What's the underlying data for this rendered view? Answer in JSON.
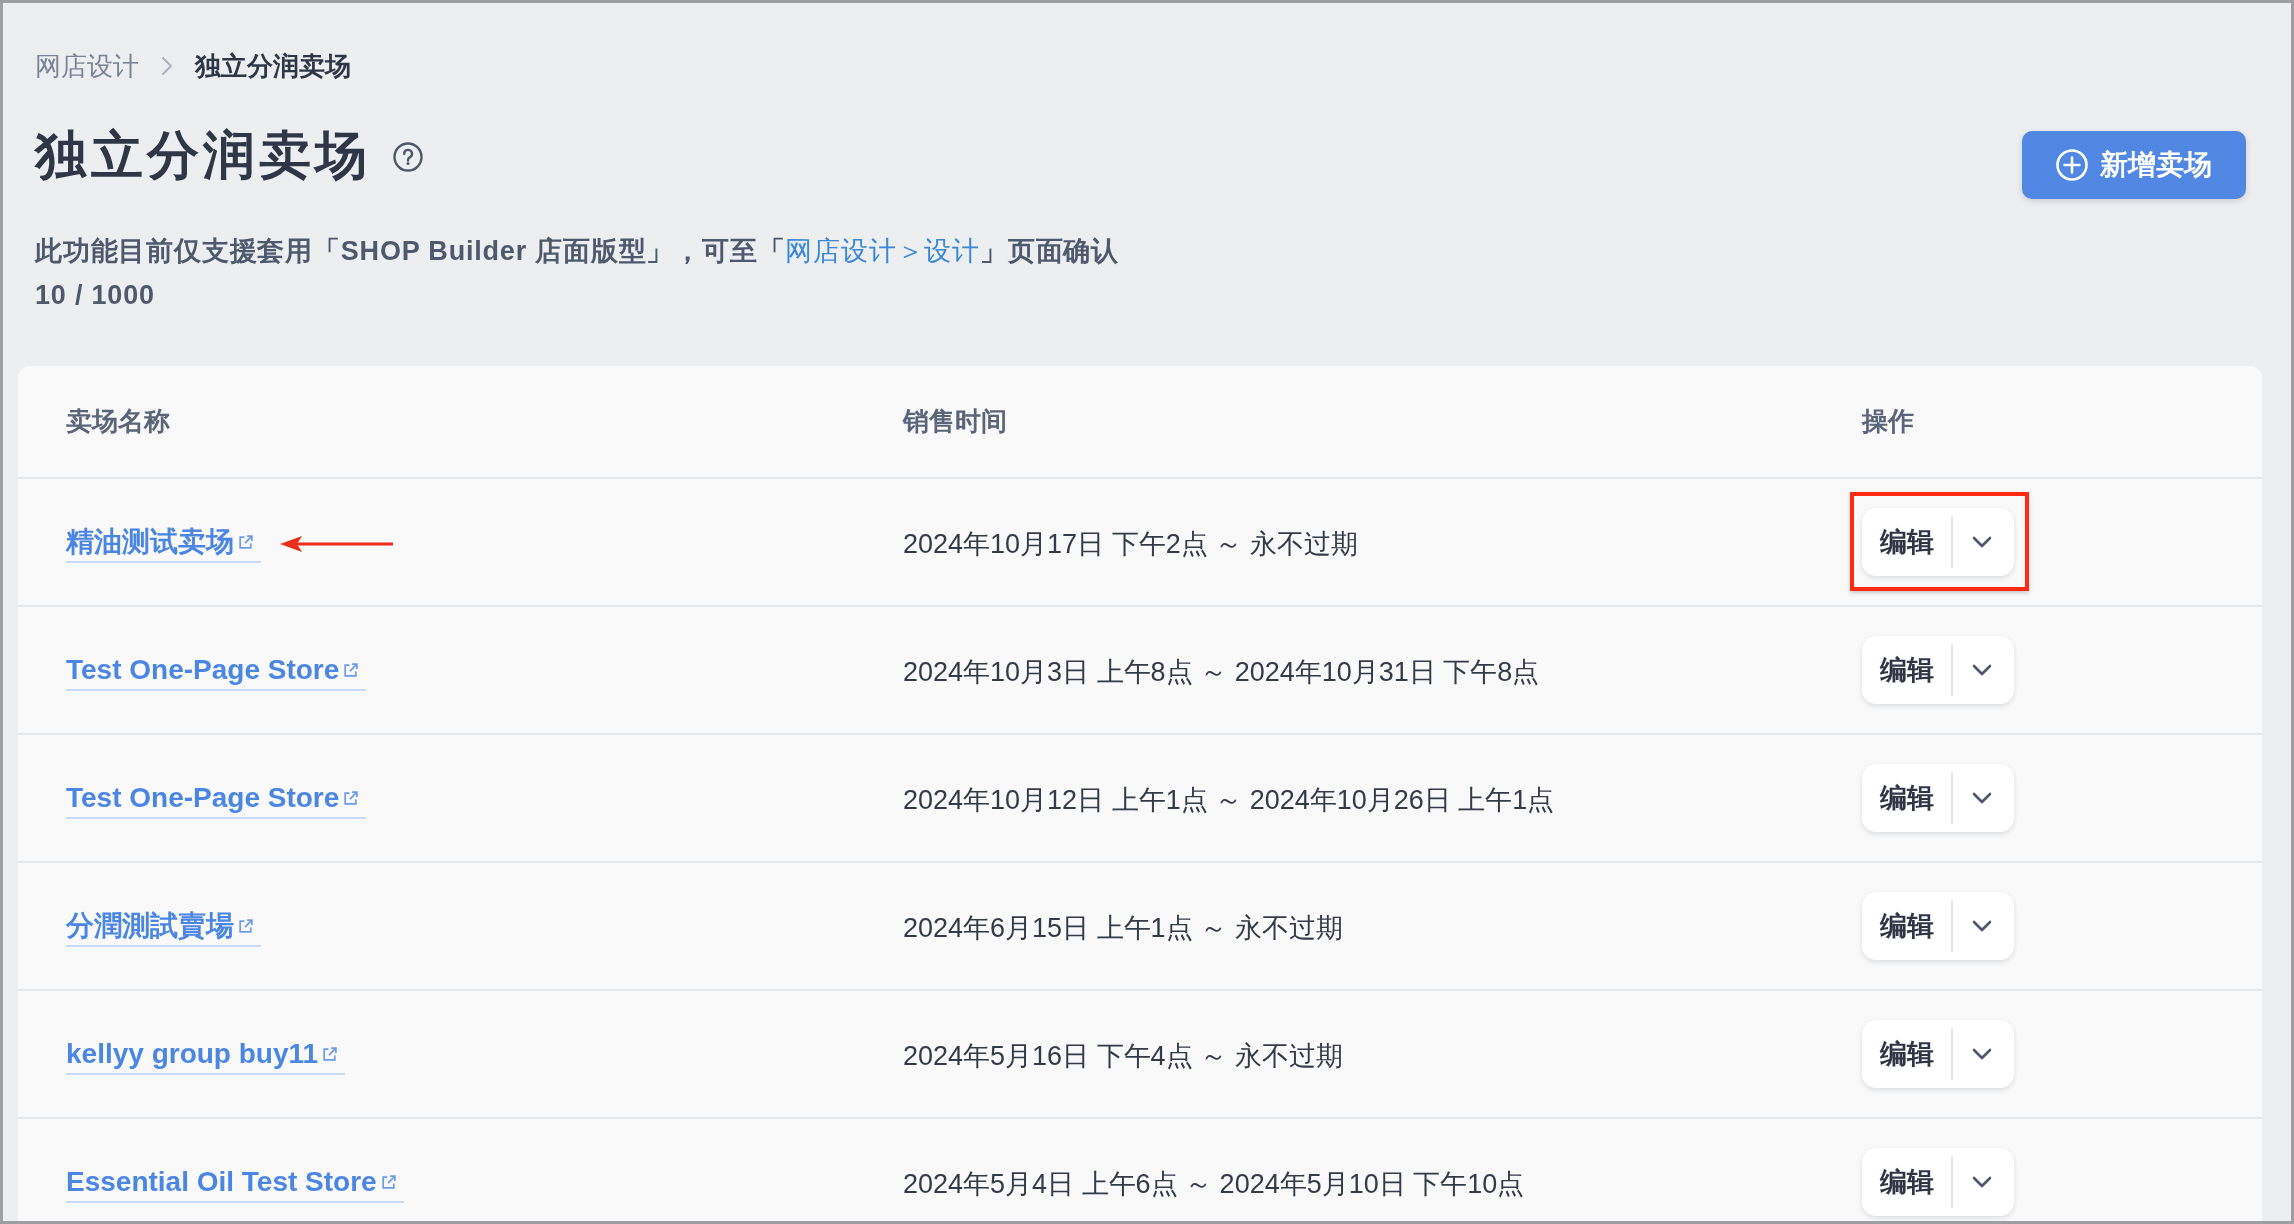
{
  "breadcrumb": [
    {
      "label": "网店设计",
      "current": false
    },
    {
      "label": "独立分润卖场",
      "current": true
    }
  ],
  "title": "独立分润卖场",
  "description": {
    "before": "此功能目前仅支援套用「SHOP Builder 店面版型」，可至「",
    "link": "网店设计＞设计",
    "after": "」页面确认"
  },
  "quota": "10 / 1000",
  "new_button": "新增卖场",
  "table": {
    "columns": [
      "卖场名称",
      "销售时间",
      "操作"
    ],
    "rows": [
      {
        "name": "精油测试卖场",
        "sale_time": "2024年10月17日 下午2点 ～ 永不过期",
        "action": "编辑",
        "arrow_annotation": true,
        "box_annotation": true
      },
      {
        "name": "Test One-Page Store",
        "sale_time": "2024年10月3日 上午8点 ～ 2024年10月31日 下午8点",
        "action": "编辑",
        "arrow_annotation": false,
        "box_annotation": false
      },
      {
        "name": "Test One-Page Store",
        "sale_time": "2024年10月12日 上午1点 ～ 2024年10月26日 上午1点",
        "action": "编辑",
        "arrow_annotation": false,
        "box_annotation": false
      },
      {
        "name": "分潤測試賣場",
        "sale_time": "2024年6月15日 上午1点 ～ 永不过期",
        "action": "编辑",
        "arrow_annotation": false,
        "box_annotation": false
      },
      {
        "name": "kellyy group buy11",
        "sale_time": "2024年5月16日 下午4点 ～ 永不过期",
        "action": "编辑",
        "arrow_annotation": false,
        "box_annotation": false
      },
      {
        "name": "Essential Oil Test Store",
        "sale_time": "2024年5月4日 上午6点 ～ 2024年5月10日 下午10点",
        "action": "编辑",
        "arrow_annotation": false,
        "box_annotation": false
      }
    ]
  }
}
